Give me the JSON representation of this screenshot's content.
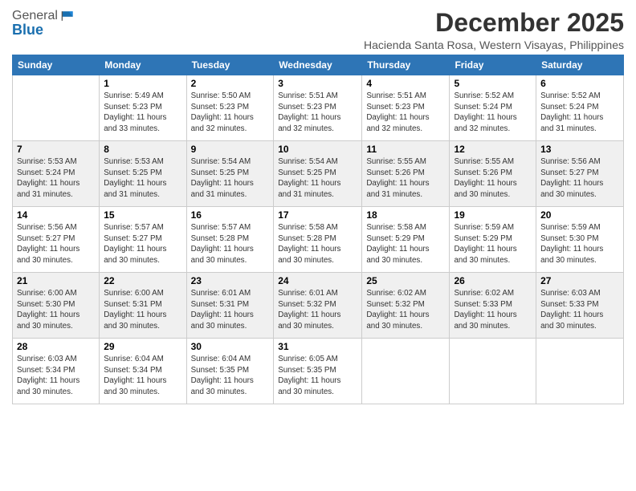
{
  "header": {
    "logo_general": "General",
    "logo_blue": "Blue",
    "month_title": "December 2025",
    "location": "Hacienda Santa Rosa, Western Visayas, Philippines"
  },
  "days_of_week": [
    "Sunday",
    "Monday",
    "Tuesday",
    "Wednesday",
    "Thursday",
    "Friday",
    "Saturday"
  ],
  "weeks": [
    [
      {
        "day": "",
        "info": ""
      },
      {
        "day": "1",
        "info": "Sunrise: 5:49 AM\nSunset: 5:23 PM\nDaylight: 11 hours\nand 33 minutes."
      },
      {
        "day": "2",
        "info": "Sunrise: 5:50 AM\nSunset: 5:23 PM\nDaylight: 11 hours\nand 32 minutes."
      },
      {
        "day": "3",
        "info": "Sunrise: 5:51 AM\nSunset: 5:23 PM\nDaylight: 11 hours\nand 32 minutes."
      },
      {
        "day": "4",
        "info": "Sunrise: 5:51 AM\nSunset: 5:23 PM\nDaylight: 11 hours\nand 32 minutes."
      },
      {
        "day": "5",
        "info": "Sunrise: 5:52 AM\nSunset: 5:24 PM\nDaylight: 11 hours\nand 32 minutes."
      },
      {
        "day": "6",
        "info": "Sunrise: 5:52 AM\nSunset: 5:24 PM\nDaylight: 11 hours\nand 31 minutes."
      }
    ],
    [
      {
        "day": "7",
        "info": "Sunrise: 5:53 AM\nSunset: 5:24 PM\nDaylight: 11 hours\nand 31 minutes."
      },
      {
        "day": "8",
        "info": "Sunrise: 5:53 AM\nSunset: 5:25 PM\nDaylight: 11 hours\nand 31 minutes."
      },
      {
        "day": "9",
        "info": "Sunrise: 5:54 AM\nSunset: 5:25 PM\nDaylight: 11 hours\nand 31 minutes."
      },
      {
        "day": "10",
        "info": "Sunrise: 5:54 AM\nSunset: 5:25 PM\nDaylight: 11 hours\nand 31 minutes."
      },
      {
        "day": "11",
        "info": "Sunrise: 5:55 AM\nSunset: 5:26 PM\nDaylight: 11 hours\nand 31 minutes."
      },
      {
        "day": "12",
        "info": "Sunrise: 5:55 AM\nSunset: 5:26 PM\nDaylight: 11 hours\nand 30 minutes."
      },
      {
        "day": "13",
        "info": "Sunrise: 5:56 AM\nSunset: 5:27 PM\nDaylight: 11 hours\nand 30 minutes."
      }
    ],
    [
      {
        "day": "14",
        "info": "Sunrise: 5:56 AM\nSunset: 5:27 PM\nDaylight: 11 hours\nand 30 minutes."
      },
      {
        "day": "15",
        "info": "Sunrise: 5:57 AM\nSunset: 5:27 PM\nDaylight: 11 hours\nand 30 minutes."
      },
      {
        "day": "16",
        "info": "Sunrise: 5:57 AM\nSunset: 5:28 PM\nDaylight: 11 hours\nand 30 minutes."
      },
      {
        "day": "17",
        "info": "Sunrise: 5:58 AM\nSunset: 5:28 PM\nDaylight: 11 hours\nand 30 minutes."
      },
      {
        "day": "18",
        "info": "Sunrise: 5:58 AM\nSunset: 5:29 PM\nDaylight: 11 hours\nand 30 minutes."
      },
      {
        "day": "19",
        "info": "Sunrise: 5:59 AM\nSunset: 5:29 PM\nDaylight: 11 hours\nand 30 minutes."
      },
      {
        "day": "20",
        "info": "Sunrise: 5:59 AM\nSunset: 5:30 PM\nDaylight: 11 hours\nand 30 minutes."
      }
    ],
    [
      {
        "day": "21",
        "info": "Sunrise: 6:00 AM\nSunset: 5:30 PM\nDaylight: 11 hours\nand 30 minutes."
      },
      {
        "day": "22",
        "info": "Sunrise: 6:00 AM\nSunset: 5:31 PM\nDaylight: 11 hours\nand 30 minutes."
      },
      {
        "day": "23",
        "info": "Sunrise: 6:01 AM\nSunset: 5:31 PM\nDaylight: 11 hours\nand 30 minutes."
      },
      {
        "day": "24",
        "info": "Sunrise: 6:01 AM\nSunset: 5:32 PM\nDaylight: 11 hours\nand 30 minutes."
      },
      {
        "day": "25",
        "info": "Sunrise: 6:02 AM\nSunset: 5:32 PM\nDaylight: 11 hours\nand 30 minutes."
      },
      {
        "day": "26",
        "info": "Sunrise: 6:02 AM\nSunset: 5:33 PM\nDaylight: 11 hours\nand 30 minutes."
      },
      {
        "day": "27",
        "info": "Sunrise: 6:03 AM\nSunset: 5:33 PM\nDaylight: 11 hours\nand 30 minutes."
      }
    ],
    [
      {
        "day": "28",
        "info": "Sunrise: 6:03 AM\nSunset: 5:34 PM\nDaylight: 11 hours\nand 30 minutes."
      },
      {
        "day": "29",
        "info": "Sunrise: 6:04 AM\nSunset: 5:34 PM\nDaylight: 11 hours\nand 30 minutes."
      },
      {
        "day": "30",
        "info": "Sunrise: 6:04 AM\nSunset: 5:35 PM\nDaylight: 11 hours\nand 30 minutes."
      },
      {
        "day": "31",
        "info": "Sunrise: 6:05 AM\nSunset: 5:35 PM\nDaylight: 11 hours\nand 30 minutes."
      },
      {
        "day": "",
        "info": ""
      },
      {
        "day": "",
        "info": ""
      },
      {
        "day": "",
        "info": ""
      }
    ]
  ]
}
